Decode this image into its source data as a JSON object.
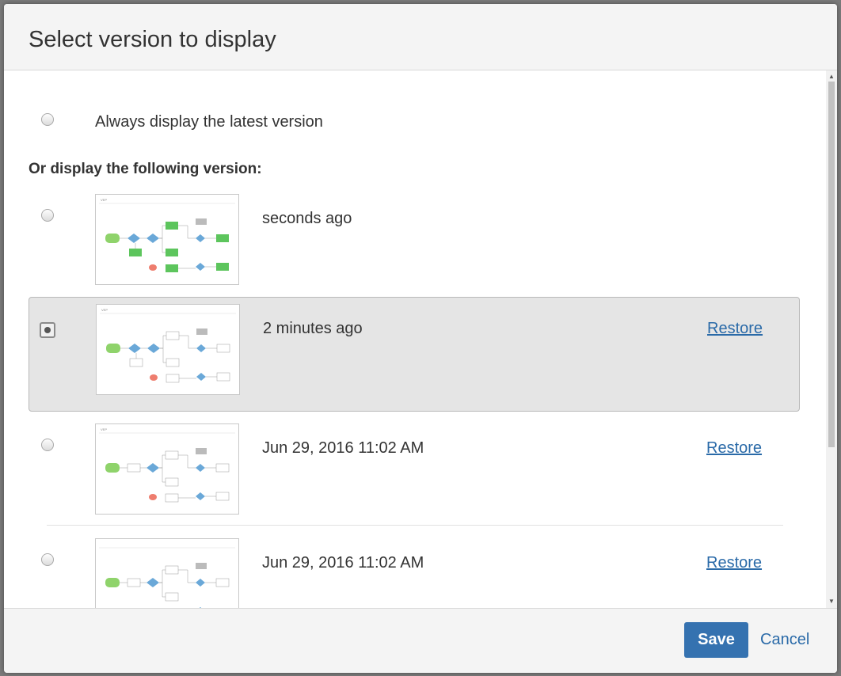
{
  "dialog": {
    "title": "Select version to display"
  },
  "latest": {
    "label": "Always display the latest version",
    "selected": false
  },
  "section": {
    "heading": "Or display the following version:"
  },
  "versions": [
    {
      "time": "seconds ago",
      "restore_label": "",
      "selected": false
    },
    {
      "time": "2 minutes ago",
      "restore_label": "Restore",
      "selected": true
    },
    {
      "time": "Jun 29, 2016 11:02 AM",
      "restore_label": "Restore",
      "selected": false
    },
    {
      "time": "Jun 29, 2016 11:02 AM",
      "restore_label": "Restore",
      "selected": false
    }
  ],
  "footer": {
    "save_label": "Save",
    "cancel_label": "Cancel"
  },
  "colors": {
    "accent": "#3572b0",
    "link": "#2a6aa8",
    "selected_row": "#e5e5e5"
  }
}
